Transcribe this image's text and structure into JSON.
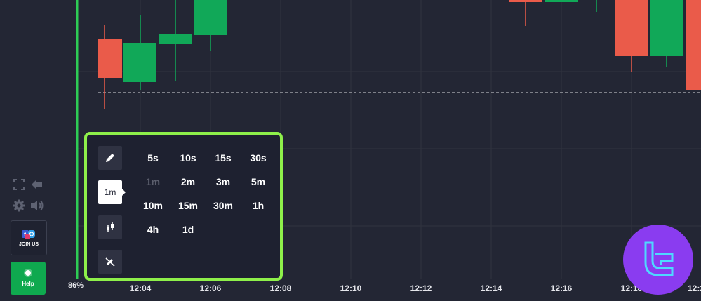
{
  "timeframe_menu": {
    "selected_label": "1m",
    "options": [
      {
        "label": "5s",
        "disabled": false
      },
      {
        "label": "10s",
        "disabled": false
      },
      {
        "label": "15s",
        "disabled": false
      },
      {
        "label": "30s",
        "disabled": false
      },
      {
        "label": "1m",
        "disabled": true
      },
      {
        "label": "2m",
        "disabled": false
      },
      {
        "label": "3m",
        "disabled": false
      },
      {
        "label": "5m",
        "disabled": false
      },
      {
        "label": "10m",
        "disabled": false
      },
      {
        "label": "15m",
        "disabled": false
      },
      {
        "label": "30m",
        "disabled": false
      },
      {
        "label": "1h",
        "disabled": false
      },
      {
        "label": "4h",
        "disabled": false
      },
      {
        "label": "1d",
        "disabled": false
      }
    ]
  },
  "side_tools": {
    "draw_icon": "pencil-icon",
    "chart_type_icon": "candlestick-icon",
    "clear_icon": "crossed-pencil-icon"
  },
  "left_panel": {
    "join_label": "JOIN US",
    "help_label": "Help",
    "icons": [
      "fullscreen-icon",
      "back-arrow-icon",
      "gear-icon",
      "sound-icon"
    ]
  },
  "progress_label": "86%",
  "colors": {
    "background": "#232634",
    "bull": "#11a858",
    "bear": "#ea5b4a",
    "highlight": "#8ef04a",
    "logo": "#8a3cf0"
  },
  "chart_data": {
    "type": "candlestick",
    "x_ticks": [
      "12:04",
      "12:06",
      "12:08",
      "12:10",
      "12:12",
      "12:14",
      "12:16",
      "12:18",
      "12:2"
    ],
    "current_price_line": "dashed"
  }
}
